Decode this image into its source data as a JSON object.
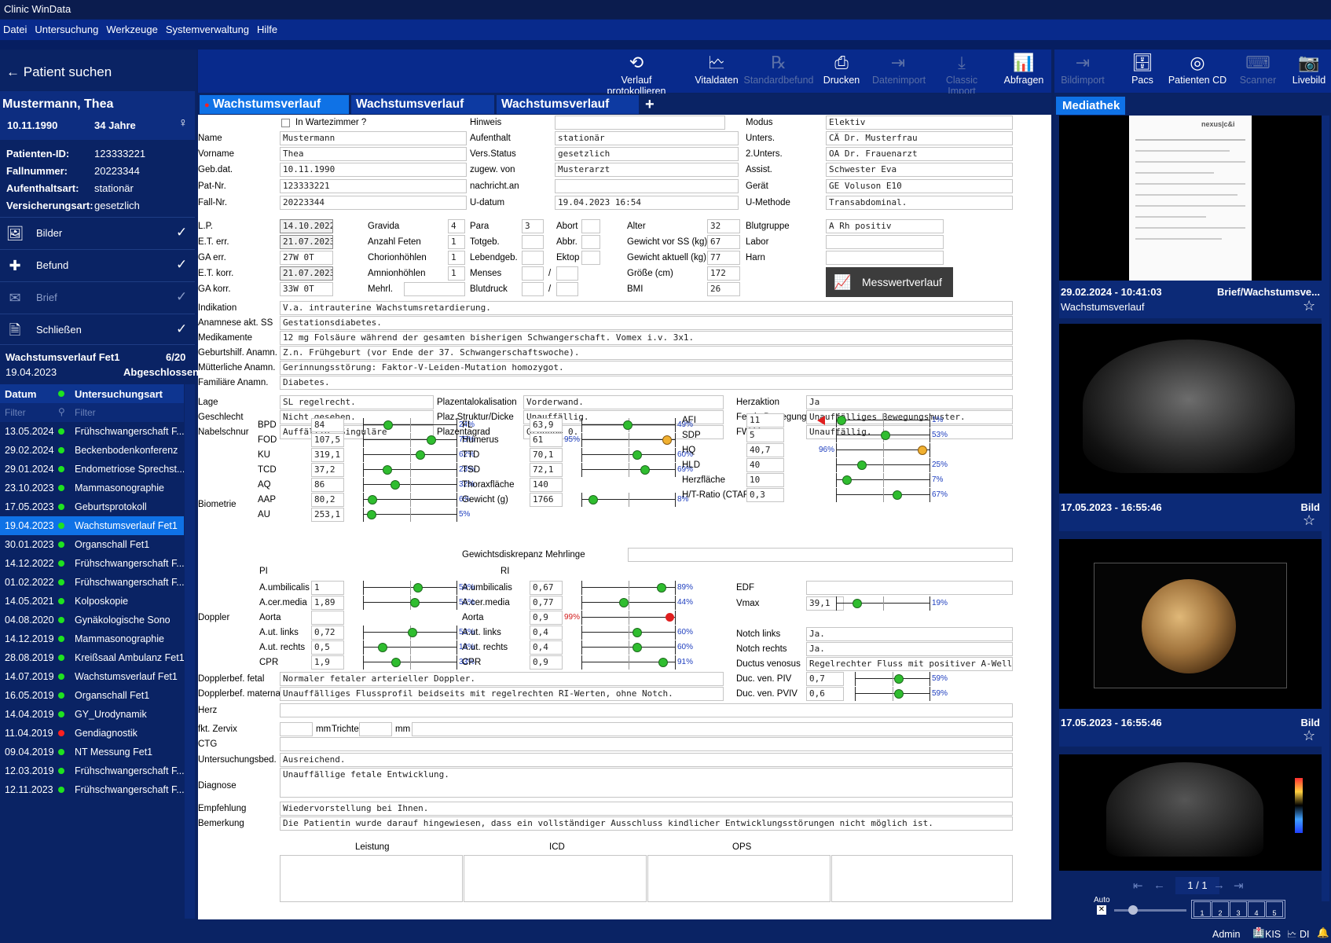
{
  "app": {
    "title": "Clinic WinData"
  },
  "menu": [
    "Datei",
    "Untersuchung",
    "Werkzeuge",
    "Systemverwaltung",
    "Hilfe"
  ],
  "sidebar": {
    "search_label": "Patient suchen",
    "patient": {
      "name": "Mustermann, Thea",
      "dob": "10.11.1990",
      "age": "34 Jahre"
    },
    "info": [
      [
        "Patienten-ID:",
        "123333221"
      ],
      [
        "Fallnummer:",
        "20223344"
      ],
      [
        "Aufenthaltsart:",
        "stationär"
      ],
      [
        "Versicherungsart:",
        "gesetzlich"
      ]
    ],
    "nav": [
      "Bilder",
      "Befund",
      "Brief",
      "Schließen"
    ],
    "exam": {
      "title": "Wachstumsverlauf Fet1",
      "count": "6/20",
      "date": "19.04.2023",
      "status": "Abgeschlossen"
    },
    "list_header": {
      "date": "Datum",
      "type": "Untersuchungsart",
      "filter": "Filter"
    },
    "items": [
      {
        "d": "13.05.2024",
        "t": "Frühschwangerschaft F..."
      },
      {
        "d": "29.02.2024",
        "t": "Beckenbodenkonferenz"
      },
      {
        "d": "29.01.2024",
        "t": "Endometriose Sprechst..."
      },
      {
        "d": "23.10.2023",
        "t": "Mammasonographie"
      },
      {
        "d": "17.05.2023",
        "t": "Geburtsprotokoll"
      },
      {
        "d": "19.04.2023",
        "t": "Wachstumsverlauf Fet1"
      },
      {
        "d": "30.01.2023",
        "t": "Organschall Fet1"
      },
      {
        "d": "14.12.2022",
        "t": "Frühschwangerschaft F..."
      },
      {
        "d": "01.02.2022",
        "t": "Frühschwangerschaft F..."
      },
      {
        "d": "14.05.2021",
        "t": "Kolposkopie"
      },
      {
        "d": "04.08.2020",
        "t": "Gynäkologische Sono"
      },
      {
        "d": "14.12.2019",
        "t": "Mammasonographie"
      },
      {
        "d": "28.08.2019",
        "t": "Kreißsaal Ambulanz Fet1"
      },
      {
        "d": "14.07.2019",
        "t": "Wachstumsverlauf Fet1"
      },
      {
        "d": "16.05.2019",
        "t": "Organschall Fet1"
      },
      {
        "d": "14.04.2019",
        "t": "GY_Urodynamik"
      },
      {
        "d": "11.04.2019",
        "t": "Gendiagnostik"
      },
      {
        "d": "09.04.2019",
        "t": "NT Messung Fet1"
      },
      {
        "d": "12.03.2019",
        "t": "Frühschwangerschaft F..."
      },
      {
        "d": "12.11.2023",
        "t": "Frühschwangerschaft F..."
      }
    ]
  },
  "toolbar": [
    "Verlauf protokollieren",
    "Vitaldaten",
    "Standardbefund",
    "Drucken",
    "Datenimport",
    "Classic Import",
    "Abfragen"
  ],
  "rtoolbar": [
    "Bildimport",
    "Pacs",
    "Patienten CD",
    "Scanner",
    "Livebild"
  ],
  "tabs": [
    "Wachstumsverlauf Fet1",
    "Wachstumsverlauf Fet2",
    "Wachstumsverlauf Fet3",
    "+"
  ],
  "form": {
    "wartezimmer": "In Wartezimmer ?",
    "hinweis": "Hinweis",
    "name_l": "Name",
    "name": "Mustermann",
    "vorname_l": "Vorname",
    "vorname": "Thea",
    "gebdat_l": "Geb.dat.",
    "gebdat": "10.11.1990",
    "patnr_l": "Pat-Nr.",
    "patnr": "123333221",
    "fallnr_l": "Fall-Nr.",
    "fallnr": "20223344",
    "aufenthalt_l": "Aufenthalt",
    "aufenthalt": "stationär",
    "vers_l": "Vers.Status",
    "vers": "gesetzlich",
    "zugew_l": "zugew. von",
    "zugew": "Musterarzt",
    "nachricht_l": "nachricht.an",
    "udatum_l": "U-datum",
    "udatum": "19.04.2023 16:54",
    "modus_l": "Modus",
    "modus": "Elektiv",
    "unters_l": "Unters.",
    "unters": "CÄ Dr. Musterfrau",
    "unters2_l": "2.Unters.",
    "unters2": "OA Dr. Frauenarzt",
    "assist_l": "Assist.",
    "assist": "Schwester Eva",
    "geraet_l": "Gerät",
    "geraet": "GE Voluson E10",
    "umeth_l": "U-Methode",
    "umeth": "Transabdominal.",
    "lp_l": "L.P.",
    "lp": "14.10.2022",
    "eterr_l": "E.T. err.",
    "eterr": "21.07.2023",
    "gaerr_l": "GA err.",
    "gaerr": "27W 0T",
    "etkorr_l": "E.T. korr.",
    "etkorr": "21.07.2023",
    "gakorr_l": "GA korr.",
    "gakorr": "33W 0T",
    "gravida_l": "Gravida",
    "gravida": "4",
    "anzfet_l": "Anzahl Feten",
    "anzfet": "1",
    "chorion_l": "Chorionhöhlen",
    "chorion": "1",
    "amnion_l": "Amnionhöhlen",
    "amnion": "1",
    "mehrl_l": "Mehrl.",
    "para_l": "Para",
    "para": "3",
    "totgeb_l": "Totgeb.",
    "lebend_l": "Lebendgeb.",
    "menses_l": "Menses",
    "slash": "/",
    "blutdruck_l": "Blutdruck",
    "abort_l": "Abort",
    "abbr_l": "Abbr.",
    "ektop_l": "Ektop",
    "alter_l": "Alter",
    "alter": "32",
    "gewvor_l": "Gewicht vor SS (kg)",
    "gewvor": "67",
    "gewakt_l": "Gewicht aktuell (kg)",
    "gewakt": "77",
    "groesse_l": "Größe (cm)",
    "groesse": "172",
    "bmi_l": "BMI",
    "bmi": "26",
    "blutgr_l": "Blutgruppe",
    "blutgr": "A Rh positiv",
    "labor_l": "Labor",
    "harn_l": "Harn",
    "messwert": "Messwertverlauf",
    "indikation_l": "Indikation",
    "indikation": "V.a. intrauterine Wachstumsretardierung.",
    "anamnese_l": "Anamnese akt. SS",
    "anamnese": "Gestationsdiabetes.",
    "medik_l": "Medikamente",
    "medik": "12 mg Folsäure während der gesamten bisherigen Schwangerschaft. Vomex i.v. 3x1.",
    "geburtsh_l": "Geburtshilf. Anamn.",
    "geburtsh": "Z.n. Frühgeburt (vor Ende der 37. Schwangerschaftswoche).",
    "muetter_l": "Mütterliche Anamn.",
    "muetter": "Gerinnungsstörung: Faktor-V-Leiden-Mutation homozygot.",
    "famil_l": "Familiäre Anamn.",
    "famil": "Diabetes.",
    "lage_l": "Lage",
    "lage": "SL regelrecht.",
    "geschl_l": "Geschlecht",
    "geschl": "Nicht gesehen.",
    "nabel_l": "Nabelschnur",
    "nabel": "Auffällig: Singuläre",
    "plazlok_l": "Plazentalokalisation",
    "plazlok": "Vorderwand.",
    "plazstr_l": "Plaz.Struktur/Dicke",
    "plazstr": "Unauffällig.",
    "plazgrad_l": "Plazentagrad",
    "plazgrad": "Grannum 0.",
    "herzakt_l": "Herzaktion",
    "herzakt": "Ja",
    "fetbew_l": "Fetale Bewegung",
    "fetbew": "Unauffälliges Bewegungsmuster.",
    "fwm_l": "FW-Menge",
    "fwm": "Unauffällig.",
    "biometrie_l": "Biometrie",
    "gewdis_l": "Gewichtsdiskrepanz Mehrlinge",
    "pi_l": "PI",
    "ri_l": "RI",
    "doppler_l": "Doppler",
    "doppfet_l": "Dopplerbef. fetal",
    "doppfet": "Normaler fetaler arterieller Doppler.",
    "doppmat_l": "Dopplerbef. maternal",
    "doppmat": "Unauffälliges Flussprofil beidseits mit regelrechten RI-Werten, ohne Notch.",
    "herz_l": "Herz",
    "zervix_l": "fkt. Zervix",
    "mm": "mm",
    "trichter_l": "Trichter",
    "ctg_l": "CTG",
    "ubed_l": "Untersuchungsbed.",
    "ubed": "Ausreichend.",
    "diagnose_l": "Diagnose",
    "diagnose": "Unauffällige fetale Entwicklung.",
    "empf_l": "Empfehlung",
    "empf": "Wiedervorstellung bei Ihnen.",
    "bem_l": "Bemerkung",
    "bem": "Die Patientin wurde darauf hingewiesen, dass ein vollständiger Ausschluss kindlicher Entwicklungsstörungen nicht möglich ist.",
    "leistung_l": "Leistung",
    "icd_l": "ICD",
    "ops_l": "OPS",
    "bio1": [
      {
        "n": "BPD",
        "v": "84",
        "p": "24%",
        "k": 24
      },
      {
        "n": "FOD",
        "v": "107,5",
        "p": "75%",
        "k": 75
      },
      {
        "n": "KU",
        "v": "319,1",
        "p": "62%",
        "k": 62
      },
      {
        "n": "TCD",
        "v": "37,2",
        "p": "23%",
        "k": 23
      },
      {
        "n": "AQ",
        "v": "86",
        "p": "32%",
        "k": 32
      },
      {
        "n": "AAP",
        "v": "80,2",
        "p": "6%",
        "k": 6
      },
      {
        "n": "AU",
        "v": "253,1",
        "p": "5%",
        "k": 5
      }
    ],
    "bio2": [
      {
        "n": "FL",
        "v": "63,9",
        "p": "49%",
        "k": 49
      },
      {
        "n": "Humerus",
        "v": "61",
        "p": "95%",
        "k": 95
      },
      {
        "n": "TTD",
        "v": "70,1",
        "p": "60%",
        "k": 60
      },
      {
        "n": "TSD",
        "v": "72,1",
        "p": "69%",
        "k": 69
      },
      {
        "n": "Thoraxfläche",
        "v": "140",
        "p": "",
        "k": -1
      },
      {
        "n": "Gewicht (g)",
        "v": "1766",
        "p": "8%",
        "k": 8
      }
    ],
    "bio3": [
      {
        "n": "AFI",
        "v": "11",
        "p": "1%",
        "k": 1
      },
      {
        "n": "SDP",
        "v": "5",
        "p": "53%",
        "k": 53
      },
      {
        "n": "HQ",
        "v": "40,7",
        "p": "96%",
        "k": 96
      },
      {
        "n": "HLD",
        "v": "40",
        "p": "25%",
        "k": 25
      },
      {
        "n": "Herzfläche",
        "v": "10",
        "p": "7%",
        "k": 7
      },
      {
        "n": "H/T-Ratio (CTAR)",
        "v": "0,3",
        "p": "67%",
        "k": 67
      }
    ],
    "pi": [
      {
        "n": "A.umbilicalis",
        "v": "1",
        "p": "59%",
        "k": 59
      },
      {
        "n": "A.cer.media",
        "v": "1,89",
        "p": "56%",
        "k": 56
      },
      {
        "n": "Aorta",
        "v": "",
        "p": "",
        "k": -1
      },
      {
        "n": "A.ut. links",
        "v": "0,72",
        "p": "53%",
        "k": 53
      },
      {
        "n": "A.ut. rechts",
        "v": "0,5",
        "p": "18%",
        "k": 18
      },
      {
        "n": "CPR",
        "v": "1,9",
        "p": "33%",
        "k": 33
      }
    ],
    "ri": [
      {
        "n": "A.umbilicalis",
        "v": "0,67",
        "p": "89%",
        "k": 89
      },
      {
        "n": "A.cer.media",
        "v": "0,77",
        "p": "44%",
        "k": 44
      },
      {
        "n": "Aorta",
        "v": "0,9",
        "p": "99%",
        "k": 99
      },
      {
        "n": "A.ut. links",
        "v": "0,4",
        "p": "60%",
        "k": 60
      },
      {
        "n": "A.ut. rechts",
        "v": "0,4",
        "p": "60%",
        "k": 60
      },
      {
        "n": "CPR",
        "v": "0,9",
        "p": "91%",
        "k": 91
      }
    ],
    "edf_l": "EDF",
    "vmax_l": "Vmax",
    "vmax": "39,1",
    "vmax_p": "19%",
    "vmax_k": 19,
    "notchl_l": "Notch links",
    "notchl": "Ja.",
    "notchr_l": "Notch rechts",
    "notchr": "Ja.",
    "ductus_l": "Ductus venosus",
    "ductus": "Regelrechter Fluss mit positiver A-Welle.",
    "dvpiv_l": "Duc. ven. PIV",
    "dvpiv": "0,7",
    "dvpiv_p": "59%",
    "dvpiv_k": 59,
    "dvpviv_l": "Duc. ven. PVIV",
    "dvpviv": "0,6",
    "dvpviv_p": "59%",
    "dvpviv_k": 59
  },
  "media": {
    "title": "Mediathek",
    "items": [
      {
        "date": "29.02.2024 - 10:41:03",
        "type": "Brief/Wachstumsve...",
        "sub": "Wachstumsverlauf"
      },
      {
        "date": "17.05.2023 - 16:55:46",
        "type": "Bild"
      },
      {
        "date": "17.05.2023 - 16:55:46",
        "type": "Bild"
      }
    ],
    "pager": "1 / 1",
    "auto": "Auto",
    "slots": [
      "1",
      "2",
      "3",
      "4",
      "5"
    ]
  },
  "status": {
    "admin": "Admin",
    "kis": "KIS",
    "di": "DI"
  }
}
